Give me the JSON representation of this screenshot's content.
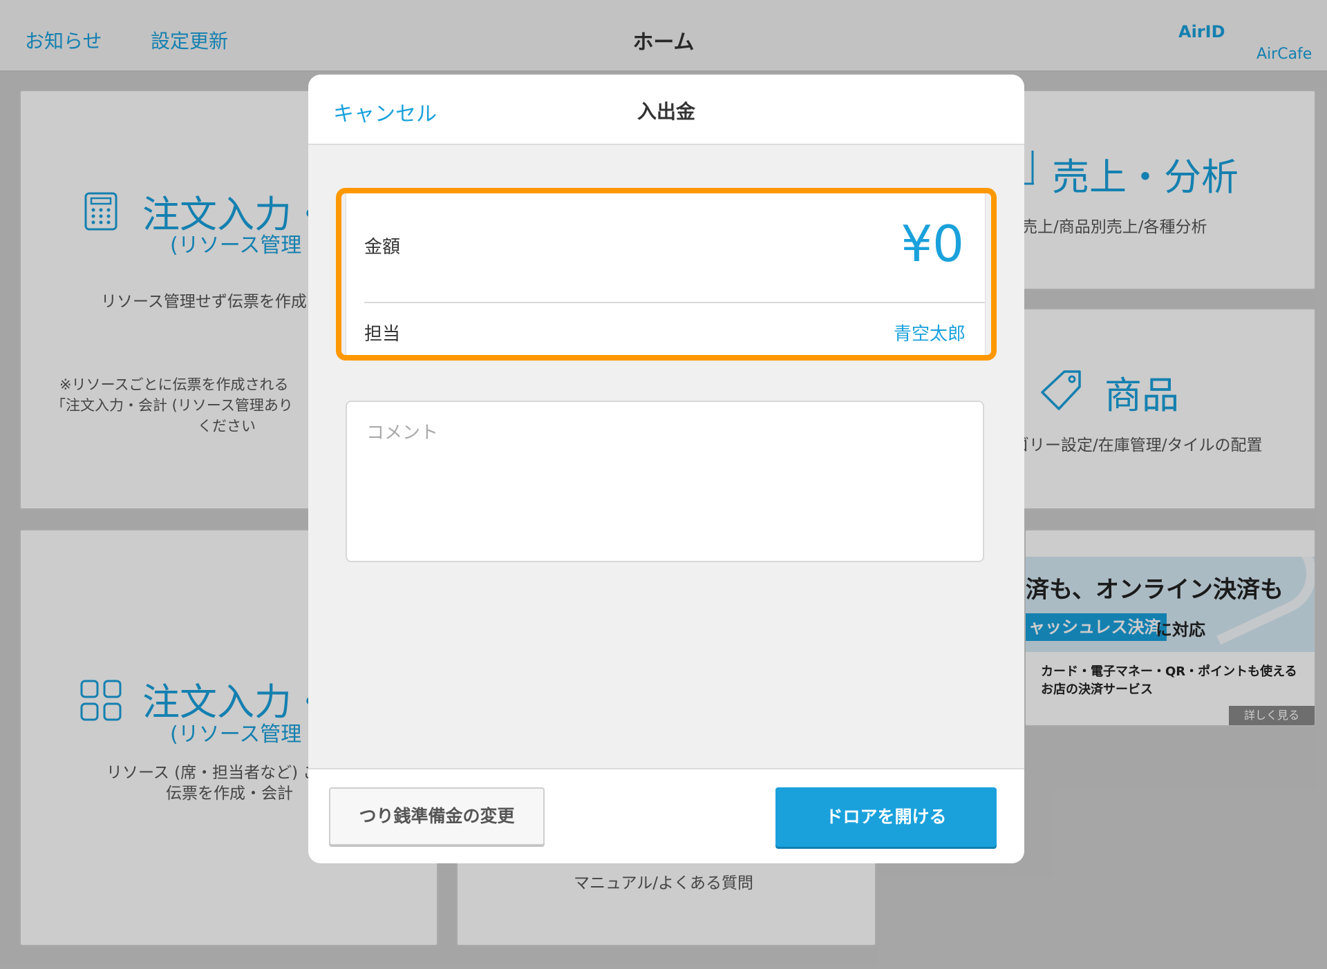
{
  "header": {
    "news_link": "お知らせ",
    "settings_update_link": "設定更新",
    "title": "ホーム",
    "airid": "AirID",
    "store_name": "AirCafe"
  },
  "tiles": {
    "order_no_resource": {
      "title": "注文入力・",
      "subtitle": "(リソース管理",
      "desc": "リソース管理せず伝票を作成",
      "note_1": "※リソースごとに伝票を作成される",
      "note_2": "「注文入力・会計 (リソース管理あり",
      "note_3": "ください"
    },
    "order_with_resource": {
      "title": "注文入力・",
      "subtitle": "(リソース管理",
      "desc_1": "リソース (席・担当者など) ご",
      "desc_2": "伝票を作成・会計"
    },
    "sales": {
      "title": "売上・分析",
      "desc": "売上/商品別売上/各種分析"
    },
    "products": {
      "title": "商品",
      "desc": "ゴリー設定/在庫管理/タイルの配置"
    },
    "help": {
      "desc": "マニュアル/よくある質問"
    }
  },
  "banner": {
    "line1": "済も、オンライン決済も",
    "highlight": "ャッシュレス決済",
    "line2_suffix": "に対応",
    "line3a": "カード・電子マネー・QR・ポイントも使える",
    "line3b": "お店の決済サービス",
    "more": "詳しく見る"
  },
  "modal": {
    "cancel": "キャンセル",
    "title": "入出金",
    "amount_label": "金額",
    "amount_value": "¥0",
    "staff_label": "担当",
    "staff_value": "青空太郎",
    "comment_placeholder": "コメント",
    "change_fund_button": "つり銭準備金の変更",
    "open_drawer_button": "ドロアを開ける"
  },
  "colors": {
    "accent": "#1aa1dc",
    "highlight_border": "#ff9800"
  }
}
